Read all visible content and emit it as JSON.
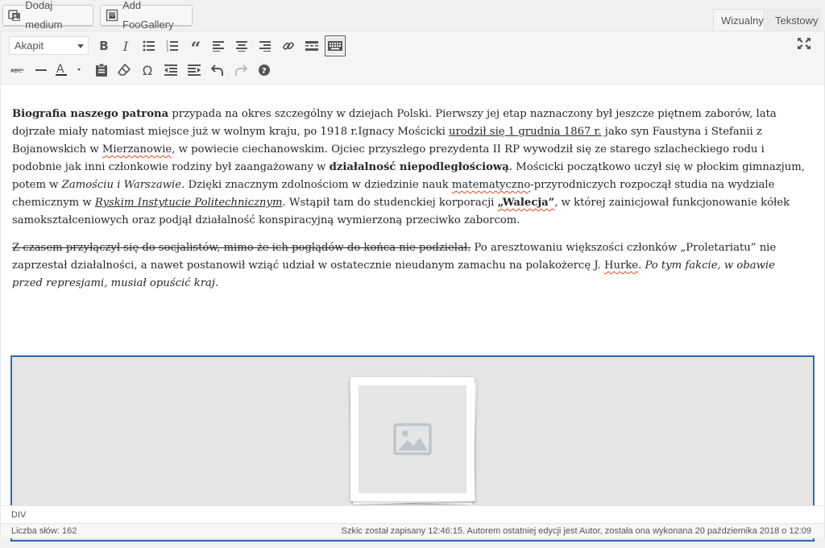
{
  "media_buttons": {
    "add_media": "Dodaj medium",
    "add_foogallery": "Add FooGallery"
  },
  "tabs": {
    "visual": "Wizualny",
    "text": "Tekstowy"
  },
  "toolbar": {
    "format_select": "Akapit",
    "row1_icons": [
      "bold-icon",
      "italic-icon",
      "bullet-list-icon",
      "numbered-list-icon",
      "blockquote-icon",
      "align-left-icon",
      "align-center-icon",
      "align-right-icon",
      "link-icon",
      "read-more-icon",
      "toolbar-toggle-icon"
    ],
    "row2_icons": [
      "strikethrough-icon",
      "horizontal-line-icon",
      "text-color-icon",
      "paste-text-icon",
      "clear-format-icon",
      "special-char-icon",
      "outdent-icon",
      "indent-icon",
      "undo-icon",
      "redo-icon",
      "help-icon"
    ],
    "fullscreen_icon": "fullscreen-icon"
  },
  "content": {
    "p1": {
      "b1": "Biografia naszego patrona",
      "t1": " przypada na okres szczególny w dziejach Polski. Pierwszy jej etap naznaczony był jeszcze piętnem zaborów, lata dojrzałe miały natomiast miejsce już w wolnym kraju, po 1918 r.Ignacy Mościcki ",
      "u1": "urodził się 1 grudnia 1867 r.",
      "t2": " jako syn Faustyna i Stefanii z Bojanowskich w ",
      "sp1": "Mierzanowie",
      "t3": ", w powiecie ciechanowskim. Ojciec przyszłego prezydenta II RP wywodził się ze starego szlacheckiego rodu i podobnie jak inni członkowie rodziny był zaangażowany w ",
      "b2": "działalność niepodległościową",
      "t4": ". Mościcki początkowo uczył się w płockim gimnazjum, potem w ",
      "i1": "Zamościu i Warszawie",
      "t5": ". Dzięki znacznym zdolnościom w dziedzinie nauk ",
      "sp2": "matematyczno",
      "t6": "-przyrodniczych rozpoczął studia na wydziale chemicznym w ",
      "iu1": "Ryskim Instytucie Politechnicznym",
      "t7": ". Wstąpił tam do studenckiej korporacji ",
      "b3": "„Walecja”",
      "t8": ", w której zainicjował funkcjonowanie kółek samokształceniowych oraz podjął działalność konspiracyjną wymierzoną przeciwko zaborcom."
    },
    "p2": {
      "s1": "Z czasem przyłączył się do socjalistów, mimo że ich poglądów do końca nie podzielał.",
      "t1": " Po aresztowaniu większości członków „Proletariatu” nie zaprzestał działalności, a nawet postanowił wziąć udział w ostatecznie nieudanym zamachu na polakożercę J. ",
      "sp1": "Hurke",
      "t2": ". ",
      "i1": "Po tym fakcie, w obawie przed represjami, musiał opuścić kraj."
    },
    "gallery_shortcode": "[foogallery id=\"70035\"]"
  },
  "path_bar": "DIV",
  "status": {
    "word_count": "Liczba słów: 162",
    "autosave": "Szkic został zapisany 12:46:15. Autorem ostatniej edycji jest Autor, została ona wykonana 20 października 2018 o 12:09"
  },
  "colors": {
    "accent": "#2a6bb5",
    "spellcheck": "#d54e21"
  }
}
